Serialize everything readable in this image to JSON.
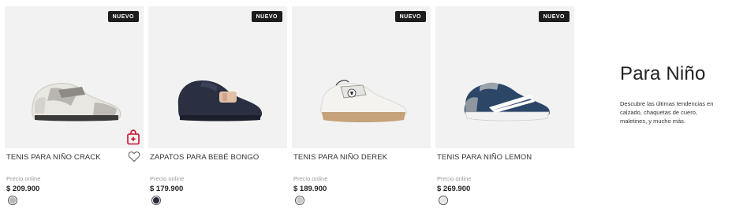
{
  "products": [
    {
      "badge": "NUEVO",
      "name": "TENIS PARA NIÑO CRACK",
      "price_label": "Precio online",
      "price": "$ 209.900",
      "swatch_color": "#b8b8b8"
    },
    {
      "badge": "NUEVO",
      "name": "ZAPATOS PARA BEBÉ BONGO",
      "price_label": "Precio online",
      "price": "$ 179.900",
      "swatch_color": "#262b3d"
    },
    {
      "badge": "NUEVO",
      "name": "TENIS PARA NIÑO DEREK",
      "price_label": "Precio online",
      "price": "$ 189.900",
      "swatch_color": "#c9c9c9"
    },
    {
      "badge": "NUEVO",
      "name": "TENIS PARA NIÑO LEMON",
      "price_label": "Precio online",
      "price": "$ 269.900",
      "swatch_color": "#e6e6e6"
    }
  ],
  "section": {
    "title": "Para Niño",
    "description": "Descubre las últimas tendencias en calzado, chaquetas de cuero, maletines, y mucho más."
  },
  "colors": {
    "badge_bg": "#1d1d1d",
    "cart_icon": "#c8102e",
    "image_bg": "#f2f2f2"
  },
  "icons": [
    "shopping-bag-icon",
    "heart-icon"
  ]
}
